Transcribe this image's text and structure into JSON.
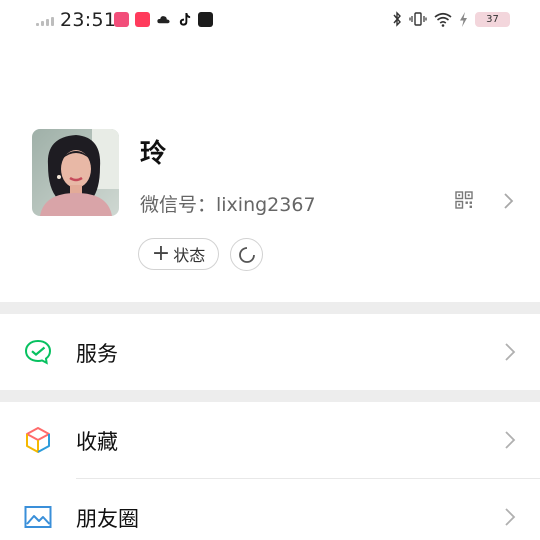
{
  "status_bar": {
    "time": "23:51",
    "battery": "37"
  },
  "profile": {
    "name": "玲",
    "wechat_id": "微信号：lixing2367",
    "status_button_label": "状态"
  },
  "menu": {
    "services": "服务",
    "favorites": "收藏",
    "moments": "朋友圈"
  },
  "colors": {
    "accent_green": "#07c160",
    "separator": "#ededed",
    "moments_blue": "#3a8fd9"
  }
}
